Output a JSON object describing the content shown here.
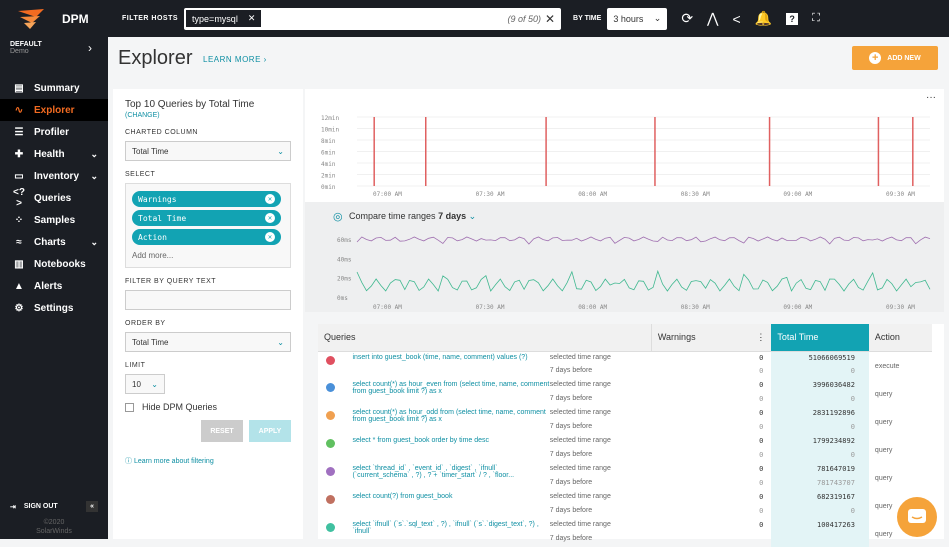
{
  "app": {
    "name": "DPM"
  },
  "topbar": {
    "filter_hosts_label": "FILTER HOSTS",
    "filter_chip": "type=mysql",
    "filter_count": "(9 of 50)",
    "by_time_label": "BY TIME",
    "time_value": "3 hours"
  },
  "sidebar": {
    "account": "DEFAULT",
    "subtitle": "Demo",
    "items": [
      {
        "label": "Summary",
        "icon": "summary-icon"
      },
      {
        "label": "Explorer",
        "icon": "explorer-icon"
      },
      {
        "label": "Profiler",
        "icon": "profiler-icon"
      },
      {
        "label": "Health",
        "icon": "health-icon"
      },
      {
        "label": "Inventory",
        "icon": "inventory-icon"
      },
      {
        "label": "Queries",
        "icon": "queries-icon"
      },
      {
        "label": "Samples",
        "icon": "samples-icon"
      },
      {
        "label": "Charts",
        "icon": "charts-icon"
      },
      {
        "label": "Notebooks",
        "icon": "notebooks-icon"
      },
      {
        "label": "Alerts",
        "icon": "alerts-icon"
      },
      {
        "label": "Settings",
        "icon": "settings-icon"
      }
    ],
    "signout": "SIGN OUT",
    "copyright": "©2020",
    "company": "SolarWinds"
  },
  "header": {
    "title": "Explorer",
    "learn_more": "LEARN MORE ›",
    "add_new": "ADD NEW"
  },
  "left": {
    "title": "Top 10 Queries by Total Time",
    "change": "(CHANGE)",
    "charted_label": "CHARTED COLUMN",
    "charted_value": "Total Time",
    "select_label": "SELECT",
    "pills": [
      "Warnings",
      "Total Time",
      "Action"
    ],
    "add_more": "Add more...",
    "filter_label": "FILTER BY QUERY TEXT",
    "order_label": "ORDER BY",
    "order_value": "Total Time",
    "limit_label": "LIMIT",
    "limit_value": "10",
    "hide_label": "Hide DPM Queries",
    "reset": "RESET",
    "apply": "APPLY",
    "learn_filter": "ⓘ Learn more about filtering"
  },
  "chart_data": [
    {
      "type": "bar",
      "y_ticks": [
        "12min",
        "10min",
        "8min",
        "6min",
        "4min",
        "2min",
        "0min"
      ],
      "x_ticks": [
        "07:00 AM",
        "07:30 AM",
        "08:00 AM",
        "08:30 AM",
        "09:00 AM",
        "09:30 AM"
      ],
      "spikes_x_fraction": [
        0.03,
        0.12,
        0.33,
        0.52,
        0.72,
        0.91,
        0.97
      ],
      "series_color": "#e06060"
    },
    {
      "type": "line",
      "title": "Compare time ranges",
      "range": "7 days",
      "y_ticks": [
        "60ms",
        "40ms",
        "20ms",
        "0ms"
      ],
      "x_ticks": [
        "07:00 AM",
        "07:30 AM",
        "08:00 AM",
        "08:30 AM",
        "09:00 AM",
        "09:30 AM"
      ],
      "series": [
        {
          "color": "#a070b0",
          "level_ms": 58
        },
        {
          "color": "#40b890",
          "level_ms": 12
        }
      ]
    }
  ],
  "table": {
    "headers": [
      "Queries",
      "Warnings",
      "Total Time",
      "Action"
    ],
    "row_labels": [
      "selected time range",
      "7 days before"
    ],
    "rows": [
      {
        "color": "#e05060",
        "query": "insert into guest_book (time, name, comment) values (?)",
        "warn": "0",
        "warn2": "0",
        "total": "51066069519",
        "total2": "0",
        "action": "execute"
      },
      {
        "color": "#4a90d9",
        "query": "select count(*) as hour_even from (select time, name, comment from guest_book limit ?) as x",
        "warn": "0",
        "warn2": "0",
        "total": "3996036482",
        "total2": "0",
        "action": "query"
      },
      {
        "color": "#f0a050",
        "query": "select count(*) as hour_odd from (select time, name, comment from guest_book limit ?) as x",
        "warn": "0",
        "warn2": "0",
        "total": "2831192896",
        "total2": "0",
        "action": "query"
      },
      {
        "color": "#60c060",
        "query": "select * from guest_book order by time desc",
        "warn": "0",
        "warn2": "0",
        "total": "1799234892",
        "total2": "0",
        "action": "query"
      },
      {
        "color": "#a070c0",
        "query": "select `thread_id` , `event_id` , `digest` , `ifnull` (`current_schema` , ?) , ? + `timer_start` / ? , `floor...",
        "warn": "0",
        "warn2": "0",
        "total": "781647019",
        "total2": "781743707",
        "action": "query"
      },
      {
        "color": "#c07060",
        "query": "select count(?) from guest_book",
        "warn": "0",
        "warn2": "0",
        "total": "682319167",
        "total2": "0",
        "action": "query"
      },
      {
        "color": "#40c0a0",
        "query": "select `ifnull` (`s`.`sql_text` , ?) , `ifnull` (`s`.`digest_text`, ?) , `ifnull`",
        "warn": "0",
        "warn2": "",
        "total": "100417263",
        "total2": "",
        "action": "query"
      }
    ]
  }
}
